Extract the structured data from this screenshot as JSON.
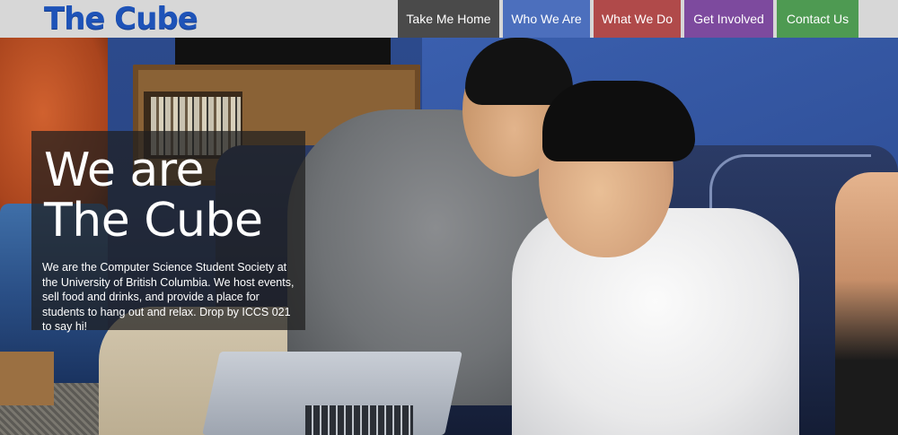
{
  "header": {
    "logo": "The Cube",
    "nav": [
      {
        "label": "Take Me Home",
        "color": "#4a4a4a"
      },
      {
        "label": "Who We Are",
        "color": "#4c6fbd"
      },
      {
        "label": "What We Do",
        "color": "#b04a4a"
      },
      {
        "label": "Get Involved",
        "color": "#7d4a9e"
      },
      {
        "label": "Contact Us",
        "color": "#4e9a52"
      }
    ]
  },
  "hero": {
    "heading_line1": "We are",
    "heading_line2": "The Cube",
    "description": "We are the Computer Science Student Society at the University of British Columbia. We host events, sell food and drinks, and provide a place for students to hang out and relax. Drop by ICCS 021 to say hi!"
  },
  "colors": {
    "header_bg": "#d7d7d7",
    "logo": "#1e53b8"
  }
}
